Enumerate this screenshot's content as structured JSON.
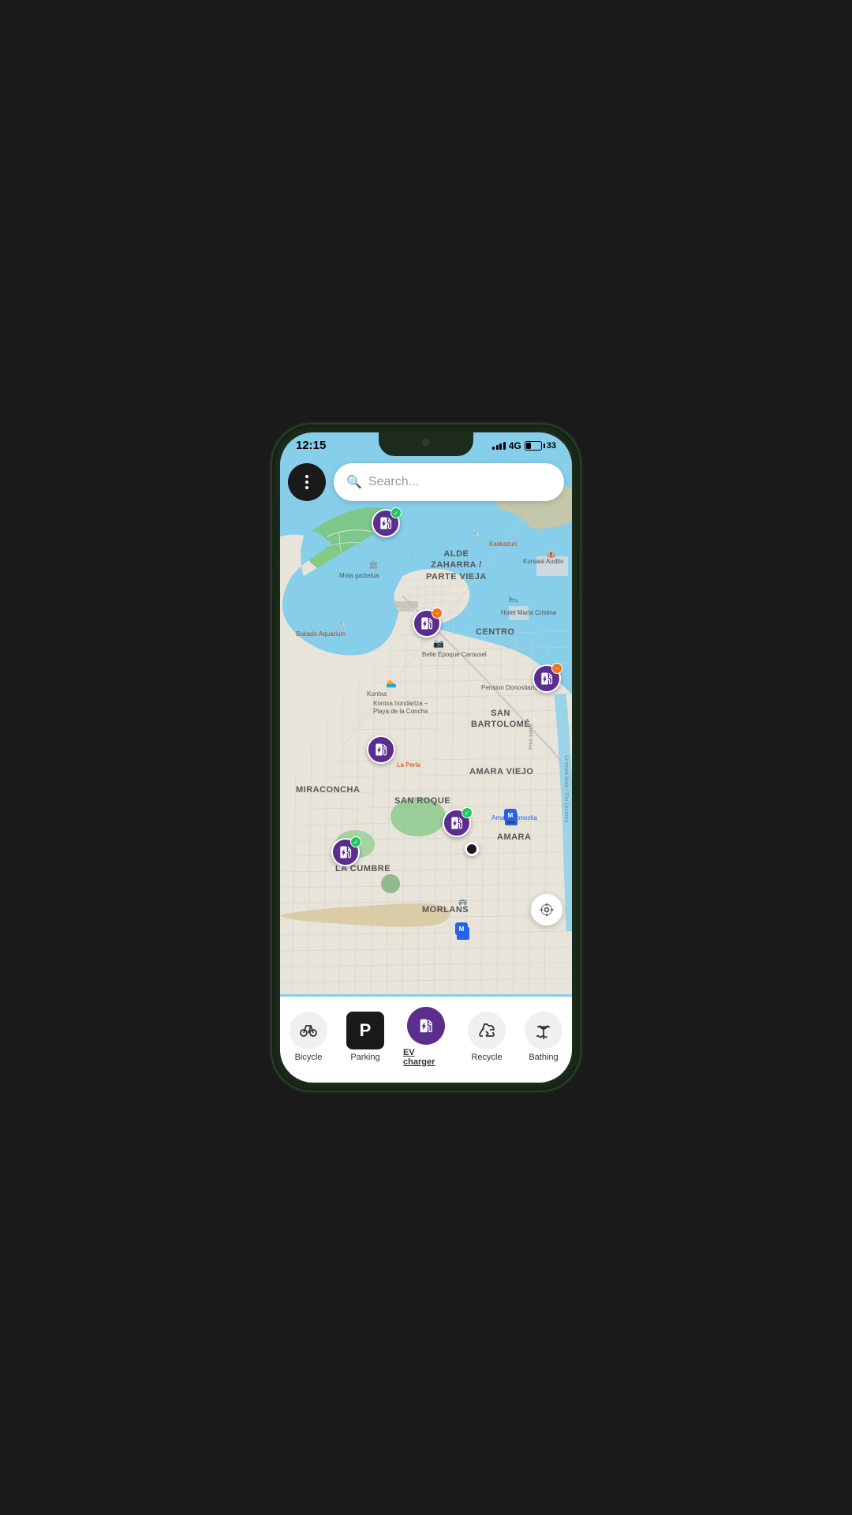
{
  "statusBar": {
    "time": "12:15",
    "network": "4G",
    "batteryLevel": "33"
  },
  "search": {
    "placeholder": "Search..."
  },
  "mapLabels": [
    {
      "id": "alde-zaharra",
      "text": "ALDE\nZAHARRA /\nPARTE VIEJA",
      "type": "area"
    },
    {
      "id": "centro",
      "text": "CENTRO",
      "type": "area"
    },
    {
      "id": "san-bartolome",
      "text": "SAN\nBARTOLOMÉ",
      "type": "area"
    },
    {
      "id": "miraconcha",
      "text": "MIRACONCHA",
      "type": "area"
    },
    {
      "id": "amara-viejo",
      "text": "AMARA VIEJO",
      "type": "area"
    },
    {
      "id": "san-roque",
      "text": "SAN ROQUE",
      "type": "area"
    },
    {
      "id": "la-cumbre",
      "text": "LA CUMBRE",
      "type": "area"
    },
    {
      "id": "amara",
      "text": "AMARA",
      "type": "area"
    },
    {
      "id": "morlans",
      "text": "MORLANS",
      "type": "area"
    },
    {
      "id": "mota-gaztelua",
      "text": "Mota gaztelua",
      "type": "poi-dark"
    },
    {
      "id": "kaskazuri",
      "text": "Kaskazuri",
      "type": "poi"
    },
    {
      "id": "bokado-aquarium",
      "text": "Bokado Aquarium",
      "type": "poi"
    },
    {
      "id": "belle-epoque",
      "text": "Belle Époque Carousel",
      "type": "poi-dark"
    },
    {
      "id": "hotel-maria",
      "text": "Hotel Maria Cristina",
      "type": "poi-dark"
    },
    {
      "id": "pension-donostiarra",
      "text": "Pension Donostiarra",
      "type": "poi-dark"
    },
    {
      "id": "kontxa",
      "text": "Kontxa",
      "type": "poi-dark"
    },
    {
      "id": "playa-concha",
      "text": "Kontxa hondartza –\nPlaya de la Concha",
      "type": "poi-dark"
    },
    {
      "id": "la-perla",
      "text": "La Perla",
      "type": "poi"
    },
    {
      "id": "kursaal",
      "text": "Kursaal Audito",
      "type": "poi-dark"
    },
    {
      "id": "amara-donostia",
      "text": "Amara-Donostia",
      "type": "poi-dark"
    },
    {
      "id": "prim-kalea",
      "text": "Prim kalea",
      "type": "poi-dark"
    }
  ],
  "evMarkers": [
    {
      "id": "ev1",
      "badge": "green",
      "left": "116",
      "top": "68"
    },
    {
      "id": "ev2",
      "badge": "orange",
      "left": "168",
      "top": "195"
    },
    {
      "id": "ev3",
      "badge": "orange",
      "left": "320",
      "top": "272"
    },
    {
      "id": "ev4",
      "badge": null,
      "left": "110",
      "top": "360"
    },
    {
      "id": "ev5",
      "badge": "green",
      "left": "206",
      "top": "450"
    },
    {
      "id": "ev6",
      "badge": null,
      "left": "65",
      "top": "485"
    }
  ],
  "bottomNav": {
    "items": [
      {
        "id": "bicycle",
        "label": "Bicycle",
        "active": false,
        "icon": "bicycle"
      },
      {
        "id": "parking",
        "label": "Parking",
        "active": false,
        "icon": "parking"
      },
      {
        "id": "ev-charger",
        "label": "EV charger",
        "active": true,
        "icon": "ev"
      },
      {
        "id": "recycle",
        "label": "Recycle",
        "active": false,
        "icon": "recycle"
      },
      {
        "id": "bathing",
        "label": "Bathing",
        "active": false,
        "icon": "bathing"
      }
    ]
  }
}
